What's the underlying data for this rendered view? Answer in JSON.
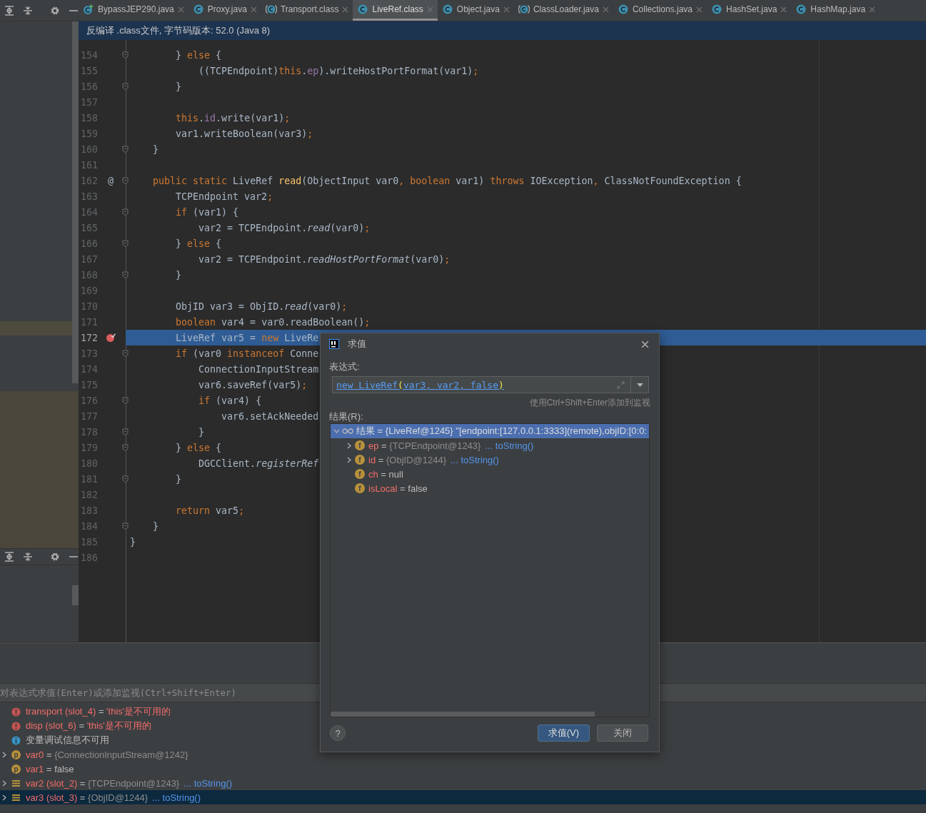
{
  "tabs": [
    {
      "label": "BypassJEP290.java",
      "kind": "main",
      "selected": false
    },
    {
      "label": "Proxy.java",
      "kind": "class",
      "selected": false
    },
    {
      "label": "Transport.class",
      "kind": "abstract",
      "selected": false
    },
    {
      "label": "LiveRef.class",
      "kind": "class",
      "selected": true
    },
    {
      "label": "Object.java",
      "kind": "class",
      "selected": false
    },
    {
      "label": "ClassLoader.java",
      "kind": "abstract",
      "selected": false
    },
    {
      "label": "Collections.java",
      "kind": "class",
      "selected": false
    },
    {
      "label": "HashSet.java",
      "kind": "class",
      "selected": false
    },
    {
      "label": "HashMap.java",
      "kind": "class",
      "selected": false
    }
  ],
  "banner": "反编译 .class文件, 字节码版本: 52.0 (Java 8)",
  "editor": {
    "lines": [
      {
        "number": "154",
        "fold": true,
        "current": false,
        "breakpoint": false,
        "tokens": [
          {
            "kind": "plain",
            "text": "        } "
          },
          {
            "kind": "keyword",
            "text": "else"
          },
          {
            "kind": "plain",
            "text": " {"
          }
        ]
      },
      {
        "number": "155",
        "fold": false,
        "current": false,
        "breakpoint": false,
        "tokens": [
          {
            "kind": "plain",
            "text": "            ((TCPEndpoint)"
          },
          {
            "kind": "keyword",
            "text": "this"
          },
          {
            "kind": "plain",
            "text": "."
          },
          {
            "kind": "field",
            "text": "ep"
          },
          {
            "kind": "plain",
            "text": ").writeHostPortFormat(var1)"
          },
          {
            "kind": "keyword",
            "text": ";"
          }
        ]
      },
      {
        "number": "156",
        "fold": true,
        "current": false,
        "breakpoint": false,
        "tokens": [
          {
            "kind": "plain",
            "text": "        }"
          }
        ]
      },
      {
        "number": "157",
        "fold": false,
        "current": false,
        "breakpoint": false
      },
      {
        "number": "158",
        "fold": false,
        "current": false,
        "breakpoint": false,
        "tokens": [
          {
            "kind": "keyword",
            "text": "        this"
          },
          {
            "kind": "plain",
            "text": "."
          },
          {
            "kind": "field",
            "text": "id"
          },
          {
            "kind": "plain",
            "text": ".write(var1)"
          },
          {
            "kind": "keyword",
            "text": ";"
          }
        ]
      },
      {
        "number": "159",
        "fold": false,
        "current": false,
        "breakpoint": false,
        "tokens": [
          {
            "kind": "plain",
            "text": "        var1.writeBoolean(var3)"
          },
          {
            "kind": "keyword",
            "text": ";"
          }
        ]
      },
      {
        "number": "160",
        "fold": true,
        "current": false,
        "breakpoint": false,
        "tokens": [
          {
            "kind": "plain",
            "text": "    }"
          }
        ]
      },
      {
        "number": "161",
        "fold": false,
        "current": false,
        "breakpoint": false
      },
      {
        "number": "162",
        "fold": true,
        "current": false,
        "breakpoint": false,
        "marker": "@",
        "tokens": [
          {
            "kind": "keyword",
            "text": "    public static "
          },
          {
            "kind": "plain",
            "text": "LiveRef "
          },
          {
            "kind": "declaration",
            "text": "read"
          },
          {
            "kind": "plain",
            "text": "(ObjectInput var0"
          },
          {
            "kind": "keyword",
            "text": ", boolean "
          },
          {
            "kind": "plain",
            "text": "var1) "
          },
          {
            "kind": "keyword",
            "text": "throws "
          },
          {
            "kind": "plain",
            "text": "IOException"
          },
          {
            "kind": "keyword",
            "text": ", "
          },
          {
            "kind": "plain",
            "text": "ClassNotFoundException {"
          }
        ]
      },
      {
        "number": "163",
        "fold": false,
        "current": false,
        "breakpoint": false,
        "tokens": [
          {
            "kind": "plain",
            "text": "        TCPEndpoint var2"
          },
          {
            "kind": "keyword",
            "text": ";"
          }
        ]
      },
      {
        "number": "164",
        "fold": true,
        "current": false,
        "breakpoint": false,
        "tokens": [
          {
            "kind": "keyword",
            "text": "        if "
          },
          {
            "kind": "plain",
            "text": "(var1) {"
          }
        ]
      },
      {
        "number": "165",
        "fold": false,
        "current": false,
        "breakpoint": false,
        "tokens": [
          {
            "kind": "plain",
            "text": "            var2 = TCPEndpoint."
          },
          {
            "kind": "static",
            "text": "read"
          },
          {
            "kind": "plain",
            "text": "(var0)"
          },
          {
            "kind": "keyword",
            "text": ";"
          }
        ]
      },
      {
        "number": "166",
        "fold": true,
        "current": false,
        "breakpoint": false,
        "tokens": [
          {
            "kind": "plain",
            "text": "        } "
          },
          {
            "kind": "keyword",
            "text": "else"
          },
          {
            "kind": "plain",
            "text": " {"
          }
        ]
      },
      {
        "number": "167",
        "fold": false,
        "current": false,
        "breakpoint": false,
        "tokens": [
          {
            "kind": "plain",
            "text": "            var2 = TCPEndpoint."
          },
          {
            "kind": "static",
            "text": "readHostPortFormat"
          },
          {
            "kind": "plain",
            "text": "(var0)"
          },
          {
            "kind": "keyword",
            "text": ";"
          }
        ]
      },
      {
        "number": "168",
        "fold": true,
        "current": false,
        "breakpoint": false,
        "tokens": [
          {
            "kind": "plain",
            "text": "        }"
          }
        ]
      },
      {
        "number": "169",
        "fold": false,
        "current": false,
        "breakpoint": false
      },
      {
        "number": "170",
        "fold": false,
        "current": false,
        "breakpoint": false,
        "tokens": [
          {
            "kind": "plain",
            "text": "        ObjID var3 = ObjID."
          },
          {
            "kind": "static",
            "text": "read"
          },
          {
            "kind": "plain",
            "text": "(var0)"
          },
          {
            "kind": "keyword",
            "text": ";"
          }
        ]
      },
      {
        "number": "171",
        "fold": false,
        "current": false,
        "breakpoint": false,
        "tokens": [
          {
            "kind": "keyword",
            "text": "        boolean "
          },
          {
            "kind": "plain",
            "text": "var4 = var0.readBoolean()"
          },
          {
            "kind": "keyword",
            "text": ";"
          }
        ]
      },
      {
        "number": "172",
        "fold": false,
        "current": true,
        "breakpoint": true,
        "tokens": [
          {
            "kind": "plain",
            "text": "        LiveRef var5 = "
          },
          {
            "kind": "keyword",
            "text": "new "
          },
          {
            "kind": "plain",
            "text": "LiveRe"
          }
        ]
      },
      {
        "number": "173",
        "fold": true,
        "current": false,
        "breakpoint": false,
        "tokens": [
          {
            "kind": "keyword",
            "text": "        if "
          },
          {
            "kind": "plain",
            "text": "(var0 "
          },
          {
            "kind": "keyword",
            "text": "instanceof "
          },
          {
            "kind": "plain",
            "text": "Conne"
          }
        ]
      },
      {
        "number": "174",
        "fold": false,
        "current": false,
        "breakpoint": false,
        "tokens": [
          {
            "kind": "plain",
            "text": "            ConnectionInputStream"
          }
        ]
      },
      {
        "number": "175",
        "fold": false,
        "current": false,
        "breakpoint": false,
        "tokens": [
          {
            "kind": "plain",
            "text": "            var6.saveRef(var5)"
          },
          {
            "kind": "keyword",
            "text": ";"
          }
        ]
      },
      {
        "number": "176",
        "fold": true,
        "current": false,
        "breakpoint": false,
        "tokens": [
          {
            "kind": "keyword",
            "text": "            if "
          },
          {
            "kind": "plain",
            "text": "(var4) {"
          }
        ]
      },
      {
        "number": "177",
        "fold": false,
        "current": false,
        "breakpoint": false,
        "tokens": [
          {
            "kind": "plain",
            "text": "                var6.setAckNeeded"
          }
        ]
      },
      {
        "number": "178",
        "fold": true,
        "current": false,
        "breakpoint": false,
        "tokens": [
          {
            "kind": "plain",
            "text": "            }"
          }
        ]
      },
      {
        "number": "179",
        "fold": true,
        "current": false,
        "breakpoint": false,
        "tokens": [
          {
            "kind": "plain",
            "text": "        } "
          },
          {
            "kind": "keyword",
            "text": "else"
          },
          {
            "kind": "plain",
            "text": " {"
          }
        ]
      },
      {
        "number": "180",
        "fold": false,
        "current": false,
        "breakpoint": false,
        "tokens": [
          {
            "kind": "plain",
            "text": "            DGCClient."
          },
          {
            "kind": "static",
            "text": "registerRef"
          }
        ]
      },
      {
        "number": "181",
        "fold": true,
        "current": false,
        "breakpoint": false,
        "tokens": [
          {
            "kind": "plain",
            "text": "        }"
          }
        ]
      },
      {
        "number": "182",
        "fold": false,
        "current": false,
        "breakpoint": false
      },
      {
        "number": "183",
        "fold": false,
        "current": false,
        "breakpoint": false,
        "tokens": [
          {
            "kind": "keyword",
            "text": "        return "
          },
          {
            "kind": "plain",
            "text": "var5"
          },
          {
            "kind": "keyword",
            "text": ";"
          }
        ]
      },
      {
        "number": "184",
        "fold": true,
        "current": false,
        "breakpoint": false,
        "tokens": [
          {
            "kind": "plain",
            "text": "    }"
          }
        ]
      },
      {
        "number": "185",
        "fold": false,
        "current": false,
        "breakpoint": false,
        "tokens": [
          {
            "kind": "plain",
            "text": "}"
          }
        ]
      },
      {
        "number": "186",
        "fold": false,
        "current": false,
        "breakpoint": false
      }
    ]
  },
  "debugger": {
    "evaluate_field": {
      "placeholder": "对表达式求值(Enter)或添加监视(Ctrl+Shift+Enter)"
    },
    "variables": [
      {
        "kind": "error",
        "name": "transport (slot_4)",
        "operator": "=",
        "value": "'this'是不可用的",
        "expandable": false,
        "selected": false
      },
      {
        "kind": "error",
        "name": "disp (slot_6)",
        "operator": "=",
        "value": "'this'是不可用的",
        "expandable": false,
        "selected": false
      },
      {
        "kind": "info",
        "message": "变量调试信息不可用",
        "expandable": false,
        "selected": false
      },
      {
        "kind": "param",
        "badge": "p",
        "name": "var0",
        "operator": "=",
        "value": "{ConnectionInputStream@1242}",
        "expandable": true,
        "selected": false
      },
      {
        "kind": "param",
        "badge": "p",
        "name": "var1",
        "operator": "=",
        "value": "false",
        "expandable": false,
        "selected": false
      },
      {
        "kind": "local",
        "name": "var2 (slot_2)",
        "operator": "=",
        "value": "{TCPEndpoint@1243}",
        "link": "... toString()",
        "expandable": true,
        "selected": false
      },
      {
        "kind": "local",
        "name": "var3 (slot_3)",
        "operator": "=",
        "value": "{ObjID@1244}",
        "link": "... toString()",
        "expandable": true,
        "selected": true
      }
    ]
  },
  "dialog": {
    "title": "求值",
    "expression_label": "表达式:",
    "expression": [
      {
        "kind": "link",
        "text": "new LiveRef"
      },
      {
        "kind": "paren",
        "text": "("
      },
      {
        "kind": "link",
        "text": "var3, var2, false"
      },
      {
        "kind": "paren",
        "text": ")"
      }
    ],
    "hint": "使用Ctrl+Shift+Enter添加到监视",
    "result_label": "结果(R):",
    "result": {
      "name": "结果",
      "operator": "=",
      "value": "{LiveRef@1245} \"[endpoint:[127.0.0.1:3333](remote),objID:[0:0:",
      "expanded": true,
      "selected": true,
      "children": [
        {
          "badge": "f",
          "name": "ep",
          "operator": "=",
          "value": "{TCPEndpoint@1243}",
          "link": "... toString()",
          "expandable": true
        },
        {
          "badge": "f",
          "name": "id",
          "operator": "=",
          "value": "{ObjID@1244}",
          "link": "... toString()",
          "expandable": true
        },
        {
          "badge": "f",
          "name": "ch",
          "operator": "=",
          "value": "null",
          "expandable": false
        },
        {
          "badge": "f",
          "name": "isLocal",
          "operator": "=",
          "value": "false",
          "expandable": false
        }
      ]
    },
    "help": "?",
    "buttons": [
      {
        "label": "求值(V)",
        "kind": "primary"
      },
      {
        "label": "关闭",
        "kind": "secondary"
      }
    ]
  }
}
